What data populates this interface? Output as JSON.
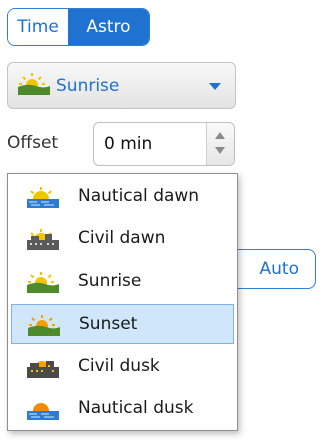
{
  "mode_toggle": {
    "time_label": "Time",
    "astro_label": "Astro",
    "selected": "Astro"
  },
  "event_dropdown": {
    "selected_label": "Sunrise",
    "selected_icon": "sunrise-icon"
  },
  "offset": {
    "label": "Offset",
    "value": "0 min"
  },
  "auto_button": {
    "label": "Auto"
  },
  "event_menu": {
    "items": [
      {
        "label": "Nautical dawn",
        "icon": "nautical-dawn-icon"
      },
      {
        "label": "Civil dawn",
        "icon": "civil-dawn-icon"
      },
      {
        "label": "Sunrise",
        "icon": "sunrise-icon"
      },
      {
        "label": "Sunset",
        "icon": "sunset-icon"
      },
      {
        "label": "Civil dusk",
        "icon": "civil-dusk-icon"
      },
      {
        "label": "Nautical dusk",
        "icon": "nautical-dusk-icon"
      }
    ],
    "highlighted_index": 3
  },
  "colors": {
    "accent": "#1f72cf",
    "highlight": "#cfe6fb",
    "sun": "#f5c400",
    "ground": "#4f8a2a",
    "water": "#2e7bd6"
  }
}
